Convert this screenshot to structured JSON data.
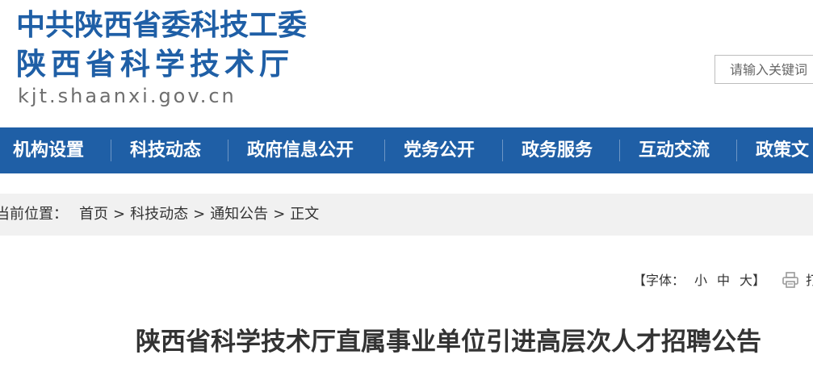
{
  "header": {
    "logo_line1": "中共陕西省委科技工委",
    "logo_line2": "陕西省科学技术厅",
    "logo_domain": "kjt.shaanxi.gov.cn",
    "search_placeholder": "请输入关键词"
  },
  "nav": {
    "items": [
      {
        "label": "机构设置"
      },
      {
        "label": "科技动态"
      },
      {
        "label": "政府信息公开"
      },
      {
        "label": "党务公开"
      },
      {
        "label": "政务服务"
      },
      {
        "label": "互动交流"
      },
      {
        "label": "政策文"
      }
    ]
  },
  "breadcrumb": {
    "prefix": "当前位置：",
    "items": [
      "首页",
      "科技动态",
      "通知公告",
      "正文"
    ],
    "separator": ">"
  },
  "font_tools": {
    "open": "【字体：",
    "small": "小",
    "medium": "中",
    "large": "大",
    "close": "】",
    "print_label": "打"
  },
  "article": {
    "title": "陕西省科学技术厅直属事业单位引进高层次人才招聘公告"
  },
  "colors": {
    "brand_blue": "#1f5fa6",
    "breadcrumb_bg": "#f1f1f1",
    "text": "#333333"
  }
}
